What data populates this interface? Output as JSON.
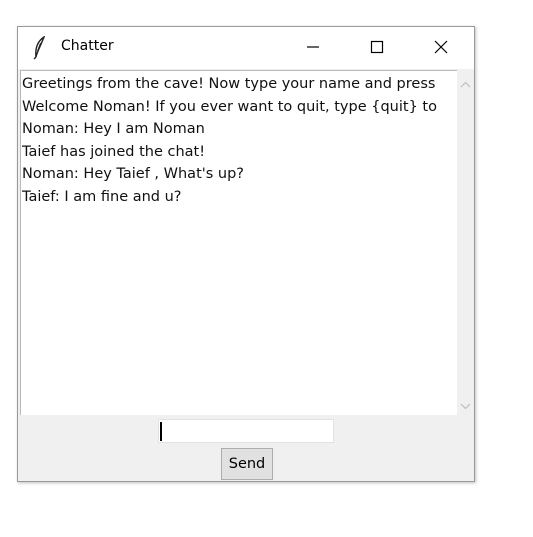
{
  "window": {
    "title": "Chatter"
  },
  "icons": {
    "app": "feather-icon",
    "minimize": "minimize-icon",
    "maximize": "maximize-icon",
    "close": "close-icon",
    "scroll_up": "chevron-up-icon",
    "scroll_down": "chevron-down-icon"
  },
  "chat": {
    "lines": [
      "Greetings from the cave! Now type your name and press",
      "Welcome Noman! If you ever want to quit, type {quit} to",
      "Noman: Hey I am Noman",
      "Taief has joined the chat!",
      "Noman: Hey Taief , What's up?",
      "Taief: I am fine and u?"
    ]
  },
  "input": {
    "value": ""
  },
  "send": {
    "label": "Send"
  }
}
